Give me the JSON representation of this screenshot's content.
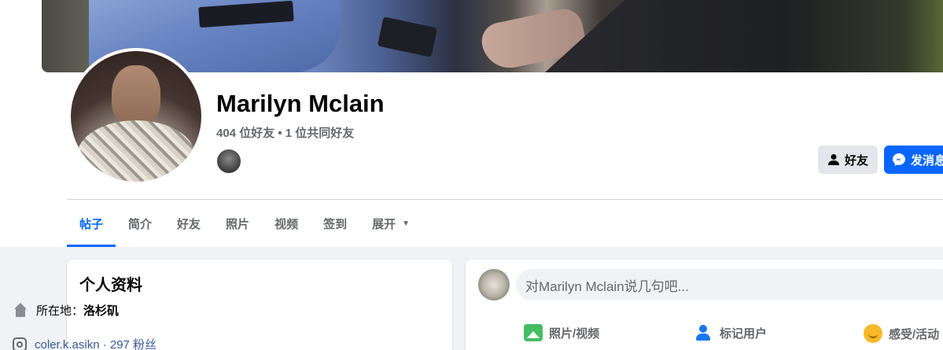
{
  "profile": {
    "name": "Marilyn Mclain",
    "friends_summary": "404 位好友 • 1 位共同好友"
  },
  "actions": {
    "friends_label": "好友",
    "message_label": "发消息"
  },
  "tabs": [
    {
      "label": "帖子",
      "active": true
    },
    {
      "label": "简介"
    },
    {
      "label": "好友"
    },
    {
      "label": "照片"
    },
    {
      "label": "视频"
    },
    {
      "label": "签到"
    },
    {
      "label": "展开"
    }
  ],
  "intro": {
    "title": "个人资料",
    "location_label": "所在地：",
    "location_value": "洛杉矶",
    "instagram": "coler.k.asikn · 297 粉丝"
  },
  "composer": {
    "placeholder": "对Marilyn Mclain说几句吧...",
    "photo_video": "照片/视频",
    "tag_people": "标记用户",
    "feeling": "感受/活动"
  },
  "colors": {
    "accent": "#0866ff",
    "background": "#f0f2f5"
  }
}
